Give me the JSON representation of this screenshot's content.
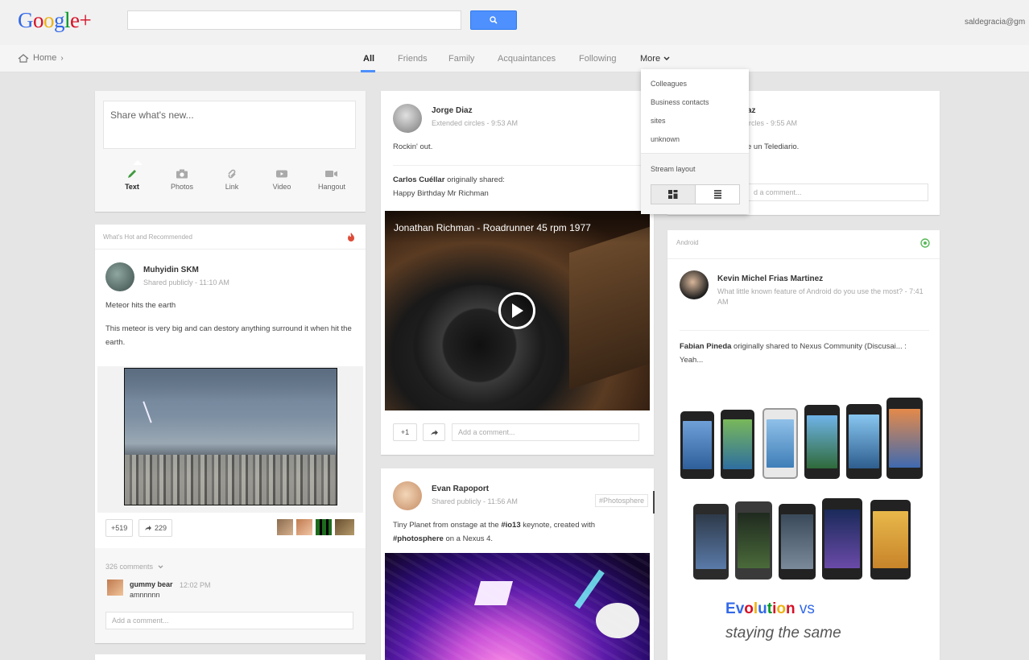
{
  "header": {
    "logo_text": "Google+",
    "search": {
      "placeholder": ""
    },
    "user_email": "saldegracia@gm"
  },
  "nav": {
    "home_label": "Home",
    "tabs": [
      {
        "label": "All",
        "active": true
      },
      {
        "label": "Friends"
      },
      {
        "label": "Family"
      },
      {
        "label": "Acquaintances"
      },
      {
        "label": "Following"
      }
    ],
    "more_label": "More"
  },
  "more_menu": {
    "items": [
      "Colleagues",
      "Business contacts",
      "sites",
      "unknown"
    ],
    "section_label": "Stream layout"
  },
  "share_box": {
    "placeholder": "Share what's new...",
    "tools": [
      "Text",
      "Photos",
      "Link",
      "Video",
      "Hangout"
    ]
  },
  "hot_card": {
    "section_title": "What's Hot and Recommended",
    "author": "Muhyidin SKM",
    "meta": "Shared publicly  -  11:10 AM",
    "text1": "Meteor hits the earth",
    "text2": "This meteor is very big and can destory anything surround it when hit the earth.",
    "plus_count": "+519",
    "share_count": "229",
    "comments_count": "326 comments",
    "commenter": "gummy bear",
    "comment_time": "12:02 PM",
    "comment_text": "amnnnnn",
    "comment_placeholder": "Add a comment..."
  },
  "jorge_post": {
    "author": "Jorge Diaz",
    "meta": "Extended circles  -  9:53 AM",
    "text": "Rockin' out.",
    "shared_by": "Carlos Cuéllar",
    "shared_suffix": "originally shared:",
    "shared_text": "Happy Birthday Mr Richman",
    "video_title": "Jonathan Richman - Roadrunner 45 rpm 1977",
    "plus_label": "+1",
    "comment_placeholder": "Add a comment..."
  },
  "evan_post": {
    "author": "Evan Rapoport",
    "meta": "Shared publicly  -  11:56 AM",
    "tag": "#Photosphere",
    "text_part1": "Tiny Planet from onstage at the ",
    "text_tag1": "#io13",
    "text_part2": " keynote, created with",
    "text_tag2": "#photosphere",
    "text_part3": " on a Nexus 4."
  },
  "partial_post": {
    "author_tail": "az",
    "meta_tail": "ircles  -  9:55 AM",
    "text_tail": "e un Telediario.",
    "comment_tail": "d a comment..."
  },
  "android_card": {
    "section_title": "Android",
    "author": "Kevin Michel Frias Martinez",
    "meta": "What little known feature of Android do you use the most?  -  7:41 AM",
    "shared_by": "Fabian Pineda",
    "shared_suffix": "originally shared to Nexus Community (Discusai... :",
    "shared_text": "Yeah...",
    "caption_line1_parts": [
      "E",
      "v",
      "o",
      "l",
      "u",
      "t",
      "i",
      "o",
      "n"
    ],
    "caption_line1_rest": " vs",
    "caption_line2": "staying the same"
  },
  "colors": {
    "accent_blue": "#4d90fe",
    "background": "#e5e5e5",
    "hot_red": "#dd4b39",
    "android_green": "#5ab85a"
  }
}
